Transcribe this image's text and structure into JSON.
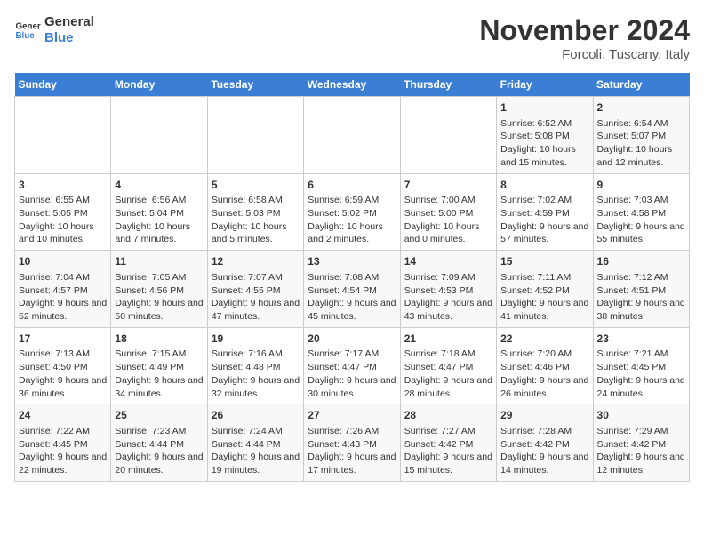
{
  "logo": {
    "line1": "General",
    "line2": "Blue"
  },
  "title": "November 2024",
  "location": "Forcoli, Tuscany, Italy",
  "days_header": [
    "Sunday",
    "Monday",
    "Tuesday",
    "Wednesday",
    "Thursday",
    "Friday",
    "Saturday"
  ],
  "weeks": [
    [
      {
        "day": "",
        "info": ""
      },
      {
        "day": "",
        "info": ""
      },
      {
        "day": "",
        "info": ""
      },
      {
        "day": "",
        "info": ""
      },
      {
        "day": "",
        "info": ""
      },
      {
        "day": "1",
        "info": "Sunrise: 6:52 AM\nSunset: 5:08 PM\nDaylight: 10 hours and 15 minutes."
      },
      {
        "day": "2",
        "info": "Sunrise: 6:54 AM\nSunset: 5:07 PM\nDaylight: 10 hours and 12 minutes."
      }
    ],
    [
      {
        "day": "3",
        "info": "Sunrise: 6:55 AM\nSunset: 5:05 PM\nDaylight: 10 hours and 10 minutes."
      },
      {
        "day": "4",
        "info": "Sunrise: 6:56 AM\nSunset: 5:04 PM\nDaylight: 10 hours and 7 minutes."
      },
      {
        "day": "5",
        "info": "Sunrise: 6:58 AM\nSunset: 5:03 PM\nDaylight: 10 hours and 5 minutes."
      },
      {
        "day": "6",
        "info": "Sunrise: 6:59 AM\nSunset: 5:02 PM\nDaylight: 10 hours and 2 minutes."
      },
      {
        "day": "7",
        "info": "Sunrise: 7:00 AM\nSunset: 5:00 PM\nDaylight: 10 hours and 0 minutes."
      },
      {
        "day": "8",
        "info": "Sunrise: 7:02 AM\nSunset: 4:59 PM\nDaylight: 9 hours and 57 minutes."
      },
      {
        "day": "9",
        "info": "Sunrise: 7:03 AM\nSunset: 4:58 PM\nDaylight: 9 hours and 55 minutes."
      }
    ],
    [
      {
        "day": "10",
        "info": "Sunrise: 7:04 AM\nSunset: 4:57 PM\nDaylight: 9 hours and 52 minutes."
      },
      {
        "day": "11",
        "info": "Sunrise: 7:05 AM\nSunset: 4:56 PM\nDaylight: 9 hours and 50 minutes."
      },
      {
        "day": "12",
        "info": "Sunrise: 7:07 AM\nSunset: 4:55 PM\nDaylight: 9 hours and 47 minutes."
      },
      {
        "day": "13",
        "info": "Sunrise: 7:08 AM\nSunset: 4:54 PM\nDaylight: 9 hours and 45 minutes."
      },
      {
        "day": "14",
        "info": "Sunrise: 7:09 AM\nSunset: 4:53 PM\nDaylight: 9 hours and 43 minutes."
      },
      {
        "day": "15",
        "info": "Sunrise: 7:11 AM\nSunset: 4:52 PM\nDaylight: 9 hours and 41 minutes."
      },
      {
        "day": "16",
        "info": "Sunrise: 7:12 AM\nSunset: 4:51 PM\nDaylight: 9 hours and 38 minutes."
      }
    ],
    [
      {
        "day": "17",
        "info": "Sunrise: 7:13 AM\nSunset: 4:50 PM\nDaylight: 9 hours and 36 minutes."
      },
      {
        "day": "18",
        "info": "Sunrise: 7:15 AM\nSunset: 4:49 PM\nDaylight: 9 hours and 34 minutes."
      },
      {
        "day": "19",
        "info": "Sunrise: 7:16 AM\nSunset: 4:48 PM\nDaylight: 9 hours and 32 minutes."
      },
      {
        "day": "20",
        "info": "Sunrise: 7:17 AM\nSunset: 4:47 PM\nDaylight: 9 hours and 30 minutes."
      },
      {
        "day": "21",
        "info": "Sunrise: 7:18 AM\nSunset: 4:47 PM\nDaylight: 9 hours and 28 minutes."
      },
      {
        "day": "22",
        "info": "Sunrise: 7:20 AM\nSunset: 4:46 PM\nDaylight: 9 hours and 26 minutes."
      },
      {
        "day": "23",
        "info": "Sunrise: 7:21 AM\nSunset: 4:45 PM\nDaylight: 9 hours and 24 minutes."
      }
    ],
    [
      {
        "day": "24",
        "info": "Sunrise: 7:22 AM\nSunset: 4:45 PM\nDaylight: 9 hours and 22 minutes."
      },
      {
        "day": "25",
        "info": "Sunrise: 7:23 AM\nSunset: 4:44 PM\nDaylight: 9 hours and 20 minutes."
      },
      {
        "day": "26",
        "info": "Sunrise: 7:24 AM\nSunset: 4:44 PM\nDaylight: 9 hours and 19 minutes."
      },
      {
        "day": "27",
        "info": "Sunrise: 7:26 AM\nSunset: 4:43 PM\nDaylight: 9 hours and 17 minutes."
      },
      {
        "day": "28",
        "info": "Sunrise: 7:27 AM\nSunset: 4:42 PM\nDaylight: 9 hours and 15 minutes."
      },
      {
        "day": "29",
        "info": "Sunrise: 7:28 AM\nSunset: 4:42 PM\nDaylight: 9 hours and 14 minutes."
      },
      {
        "day": "30",
        "info": "Sunrise: 7:29 AM\nSunset: 4:42 PM\nDaylight: 9 hours and 12 minutes."
      }
    ]
  ]
}
